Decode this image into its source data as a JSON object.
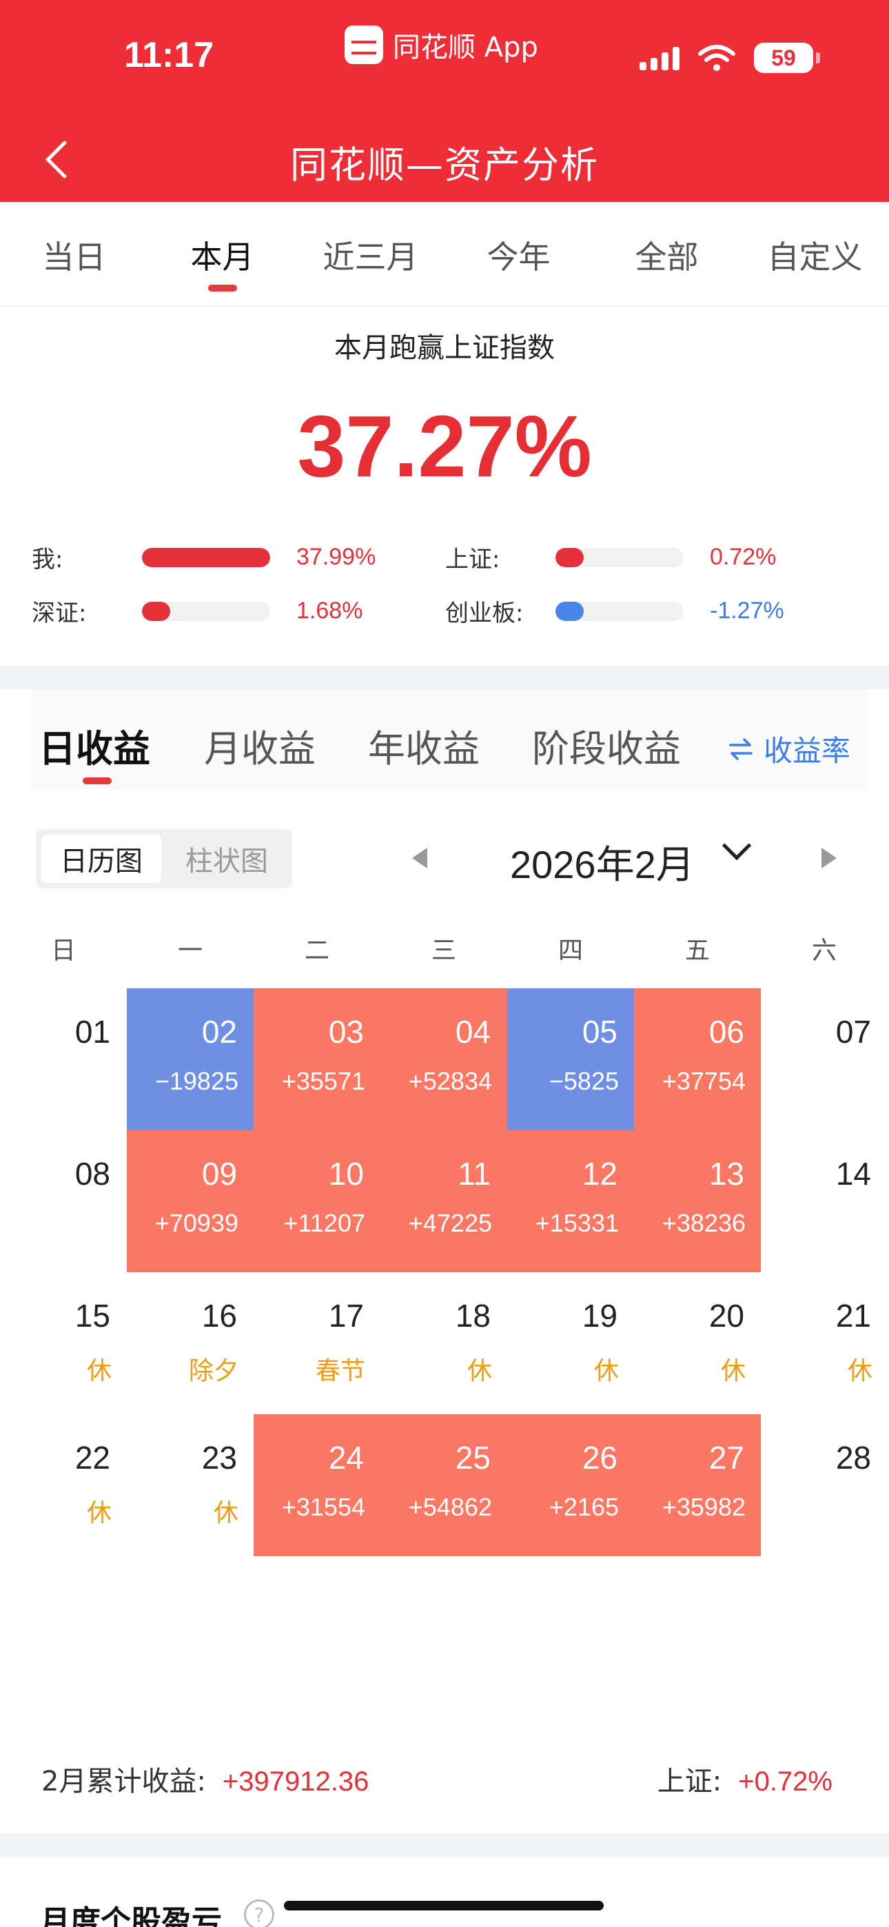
{
  "status_bar": {
    "time": "11:17",
    "app_name": "同花顺 App",
    "battery": "59"
  },
  "header": {
    "title": "同花顺—资产分析"
  },
  "period_tabs": [
    "当日",
    "本月",
    "近三月",
    "今年",
    "全部",
    "自定义"
  ],
  "period_active": "本月",
  "summary": {
    "title": "本月跑赢上证指数",
    "value": "37.27%",
    "comparisons": [
      {
        "label": "我:",
        "value": "37.99%",
        "fill": 1.0,
        "color": "#e5323a",
        "value_color": "#e5323a"
      },
      {
        "label": "上证:",
        "value": "0.72%",
        "fill": 0.12,
        "color": "#e5323a",
        "value_color": "#e5323a"
      },
      {
        "label": "深证:",
        "value": "1.68%",
        "fill": 0.13,
        "color": "#e5323a",
        "value_color": "#e5323a"
      },
      {
        "label": "创业板:",
        "value": "-1.27%",
        "fill": 0.13,
        "color": "#4a86e8",
        "value_color": "#3b7ee8"
      }
    ]
  },
  "profit_tabs": [
    "日收益",
    "月收益",
    "年收益",
    "阶段收益"
  ],
  "rate_toggle": {
    "icon": "swap-icon",
    "label": "收益率"
  },
  "view_toggle": {
    "active": "日历图",
    "inactive": "柱状图"
  },
  "month": "2026年2月",
  "weekdays": [
    "日",
    "一",
    "二",
    "三",
    "四",
    "五",
    "六"
  ],
  "calendar": [
    [
      {
        "day": "01",
        "sub": "",
        "type": "plain"
      },
      {
        "day": "02",
        "sub": "−19825",
        "type": "loss"
      },
      {
        "day": "03",
        "sub": "+35571",
        "type": "profit"
      },
      {
        "day": "04",
        "sub": "+52834",
        "type": "profit"
      },
      {
        "day": "05",
        "sub": "−5825",
        "type": "loss"
      },
      {
        "day": "06",
        "sub": "+37754",
        "type": "profit"
      },
      {
        "day": "07",
        "sub": "",
        "type": "plain"
      }
    ],
    [
      {
        "day": "08",
        "sub": "",
        "type": "plain"
      },
      {
        "day": "09",
        "sub": "+70939",
        "type": "profit"
      },
      {
        "day": "10",
        "sub": "+11207",
        "type": "profit"
      },
      {
        "day": "11",
        "sub": "+47225",
        "type": "profit"
      },
      {
        "day": "12",
        "sub": "+15331",
        "type": "profit"
      },
      {
        "day": "13",
        "sub": "+38236",
        "type": "profit"
      },
      {
        "day": "14",
        "sub": "",
        "type": "plain"
      }
    ],
    [
      {
        "day": "15",
        "sub": "休",
        "type": "plain"
      },
      {
        "day": "16",
        "sub": "除夕",
        "type": "plain"
      },
      {
        "day": "17",
        "sub": "春节",
        "type": "plain"
      },
      {
        "day": "18",
        "sub": "休",
        "type": "plain"
      },
      {
        "day": "19",
        "sub": "休",
        "type": "plain"
      },
      {
        "day": "20",
        "sub": "休",
        "type": "plain"
      },
      {
        "day": "21",
        "sub": "休",
        "type": "plain"
      }
    ],
    [
      {
        "day": "22",
        "sub": "休",
        "type": "plain"
      },
      {
        "day": "23",
        "sub": "休",
        "type": "plain"
      },
      {
        "day": "24",
        "sub": "+31554",
        "type": "profit"
      },
      {
        "day": "25",
        "sub": "+54862",
        "type": "profit"
      },
      {
        "day": "26",
        "sub": "+2165",
        "type": "profit"
      },
      {
        "day": "27",
        "sub": "+35982",
        "type": "profit"
      },
      {
        "day": "28",
        "sub": "",
        "type": "plain"
      }
    ]
  ],
  "footer": {
    "left_label": "2月累计收益:",
    "left_value": "+397912.36",
    "right_label": "上证:",
    "right_value": "+0.72%"
  },
  "bottom_section": {
    "title": "月度个股盈亏",
    "help_icon": "?"
  },
  "colors": {
    "header": "#ef2d37",
    "profit": "#fa7763",
    "loss": "#6e8fe4",
    "accent_blue": "#3b7ee8"
  }
}
